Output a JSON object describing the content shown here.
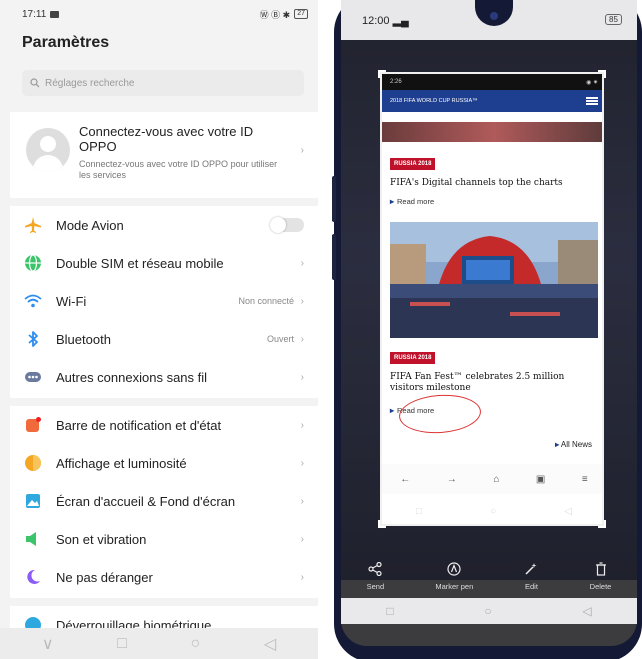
{
  "left": {
    "status": {
      "time": "17:11",
      "battery": "27",
      "indicators": "Ⓦ Ⓑ ✱"
    },
    "title": "Paramètres",
    "search_placeholder": "Réglages recherche",
    "account": {
      "title": "Connectez-vous avec votre ID OPPO",
      "subtitle": "Connectez-vous avec votre ID OPPO pour utiliser les services",
      "chevron": "›"
    },
    "network_rows": [
      {
        "label": "Mode Avion",
        "value": "",
        "icon": "airplane-icon",
        "color": "#f5a623"
      },
      {
        "label": "Double SIM et réseau mobile",
        "value": "",
        "icon": "globe-icon",
        "color": "#3cc46a"
      },
      {
        "label": "Wi-Fi",
        "value": "Non connecté",
        "icon": "wifi-icon",
        "color": "#2d8ef0"
      },
      {
        "label": "Bluetooth",
        "value": "Ouvert",
        "icon": "bluetooth-icon",
        "color": "#2d8ef0"
      },
      {
        "label": "Autres connexions sans fil",
        "value": "",
        "icon": "connections-icon",
        "color": "#6a7a9c"
      }
    ],
    "display_rows": [
      {
        "label": "Barre de notification et d'état",
        "icon": "notification-icon",
        "color": "#f06a3c"
      },
      {
        "label": "Affichage et luminosité",
        "icon": "brightness-icon",
        "color": "#f5a623"
      },
      {
        "label": "Écran d'accueil & Fond d'écran",
        "icon": "wallpaper-icon",
        "color": "#2fa8e0"
      },
      {
        "label": "Son et vibration",
        "icon": "sound-icon",
        "color": "#3cc46a"
      },
      {
        "label": "Ne pas déranger",
        "icon": "moon-icon",
        "color": "#8b5cf6"
      }
    ],
    "partial_row": "Déverrouillage biométrique",
    "chevron": "›",
    "nav": {
      "back": "∨",
      "recent": "□",
      "home": "○",
      "previous": "◁"
    }
  },
  "right": {
    "status": {
      "time": "12:00",
      "battery": "85"
    },
    "screenshot": {
      "status_time": "2:26",
      "status_icons": "◉ ✷",
      "site_title": "2018 FIFA WORLD CUP RUSSIA™",
      "article1": {
        "tag": "RUSSIA 2018",
        "headline": "FIFA's Digital channels top the charts",
        "readmore": "Read more"
      },
      "article2": {
        "tag": "RUSSIA 2018",
        "headline": "FIFA Fan Fest™ celebrates 2.5 million visitors milestone",
        "readmore": "Read more"
      },
      "all_news": "All News",
      "browser_nav": {
        "back": "←",
        "forward": "→",
        "home": "⌂",
        "tabs": "▣",
        "menu": "≡"
      },
      "sys_nav": {
        "recent": "□",
        "home": "○",
        "back": "◁"
      }
    },
    "toolbar": [
      {
        "label": "Send",
        "icon": "share-icon",
        "glyph": "⑂"
      },
      {
        "label": "Marker pen",
        "icon": "marker-pen-icon",
        "glyph": "Ⓐ"
      },
      {
        "label": "Edit",
        "icon": "edit-wand-icon",
        "glyph": "✧"
      },
      {
        "label": "Delete",
        "icon": "trash-icon",
        "glyph": "␡"
      }
    ],
    "nav": {
      "recent": "□",
      "home": "○",
      "back": "◁"
    }
  }
}
